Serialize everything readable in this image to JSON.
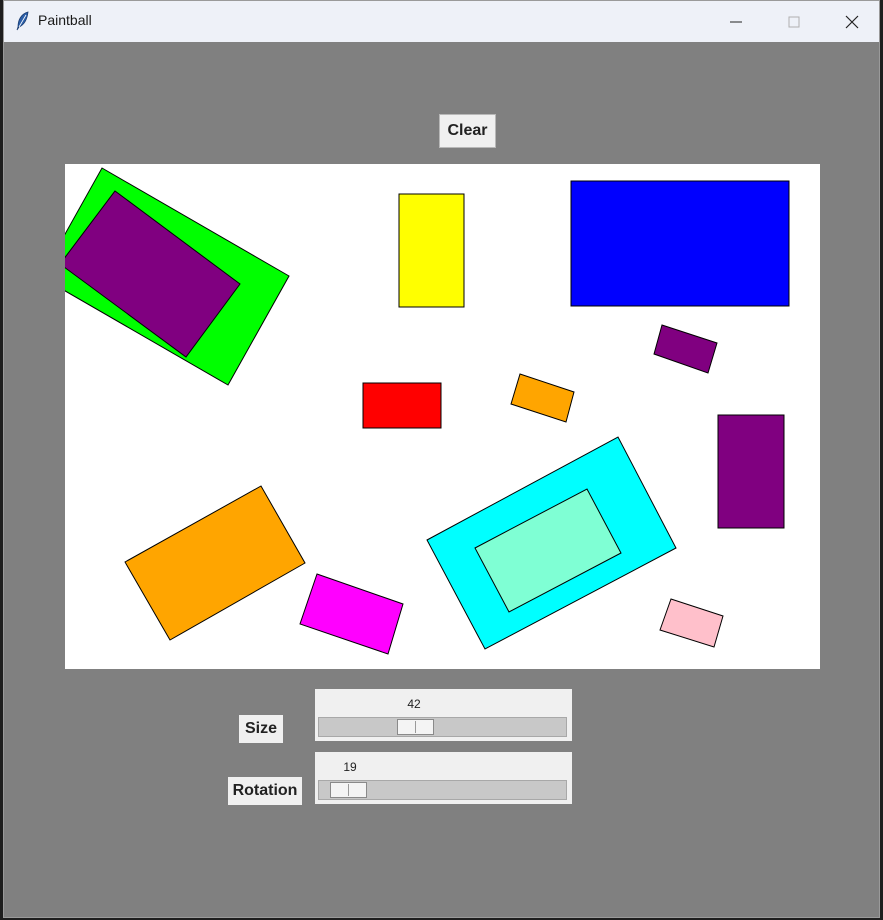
{
  "window": {
    "title": "Paintball",
    "icon": "feather-icon"
  },
  "titlebar_buttons": {
    "minimize": "minimize-icon",
    "maximize": "maximize-icon",
    "close": "close-icon"
  },
  "toolbar": {
    "clear_label": "Clear"
  },
  "controls": {
    "size": {
      "label": "Size",
      "value": "42"
    },
    "rotation": {
      "label": "Rotation",
      "value": "19"
    }
  },
  "colors": {
    "window_bg": "#808080",
    "canvas_bg": "#ffffff",
    "shapes": [
      "#00ff00",
      "#800080",
      "#ffff00",
      "#0000ff",
      "#ff0000",
      "#ffa500",
      "#00ffff",
      "#7fffd4",
      "#ff00ff",
      "#ffc0cb"
    ]
  }
}
